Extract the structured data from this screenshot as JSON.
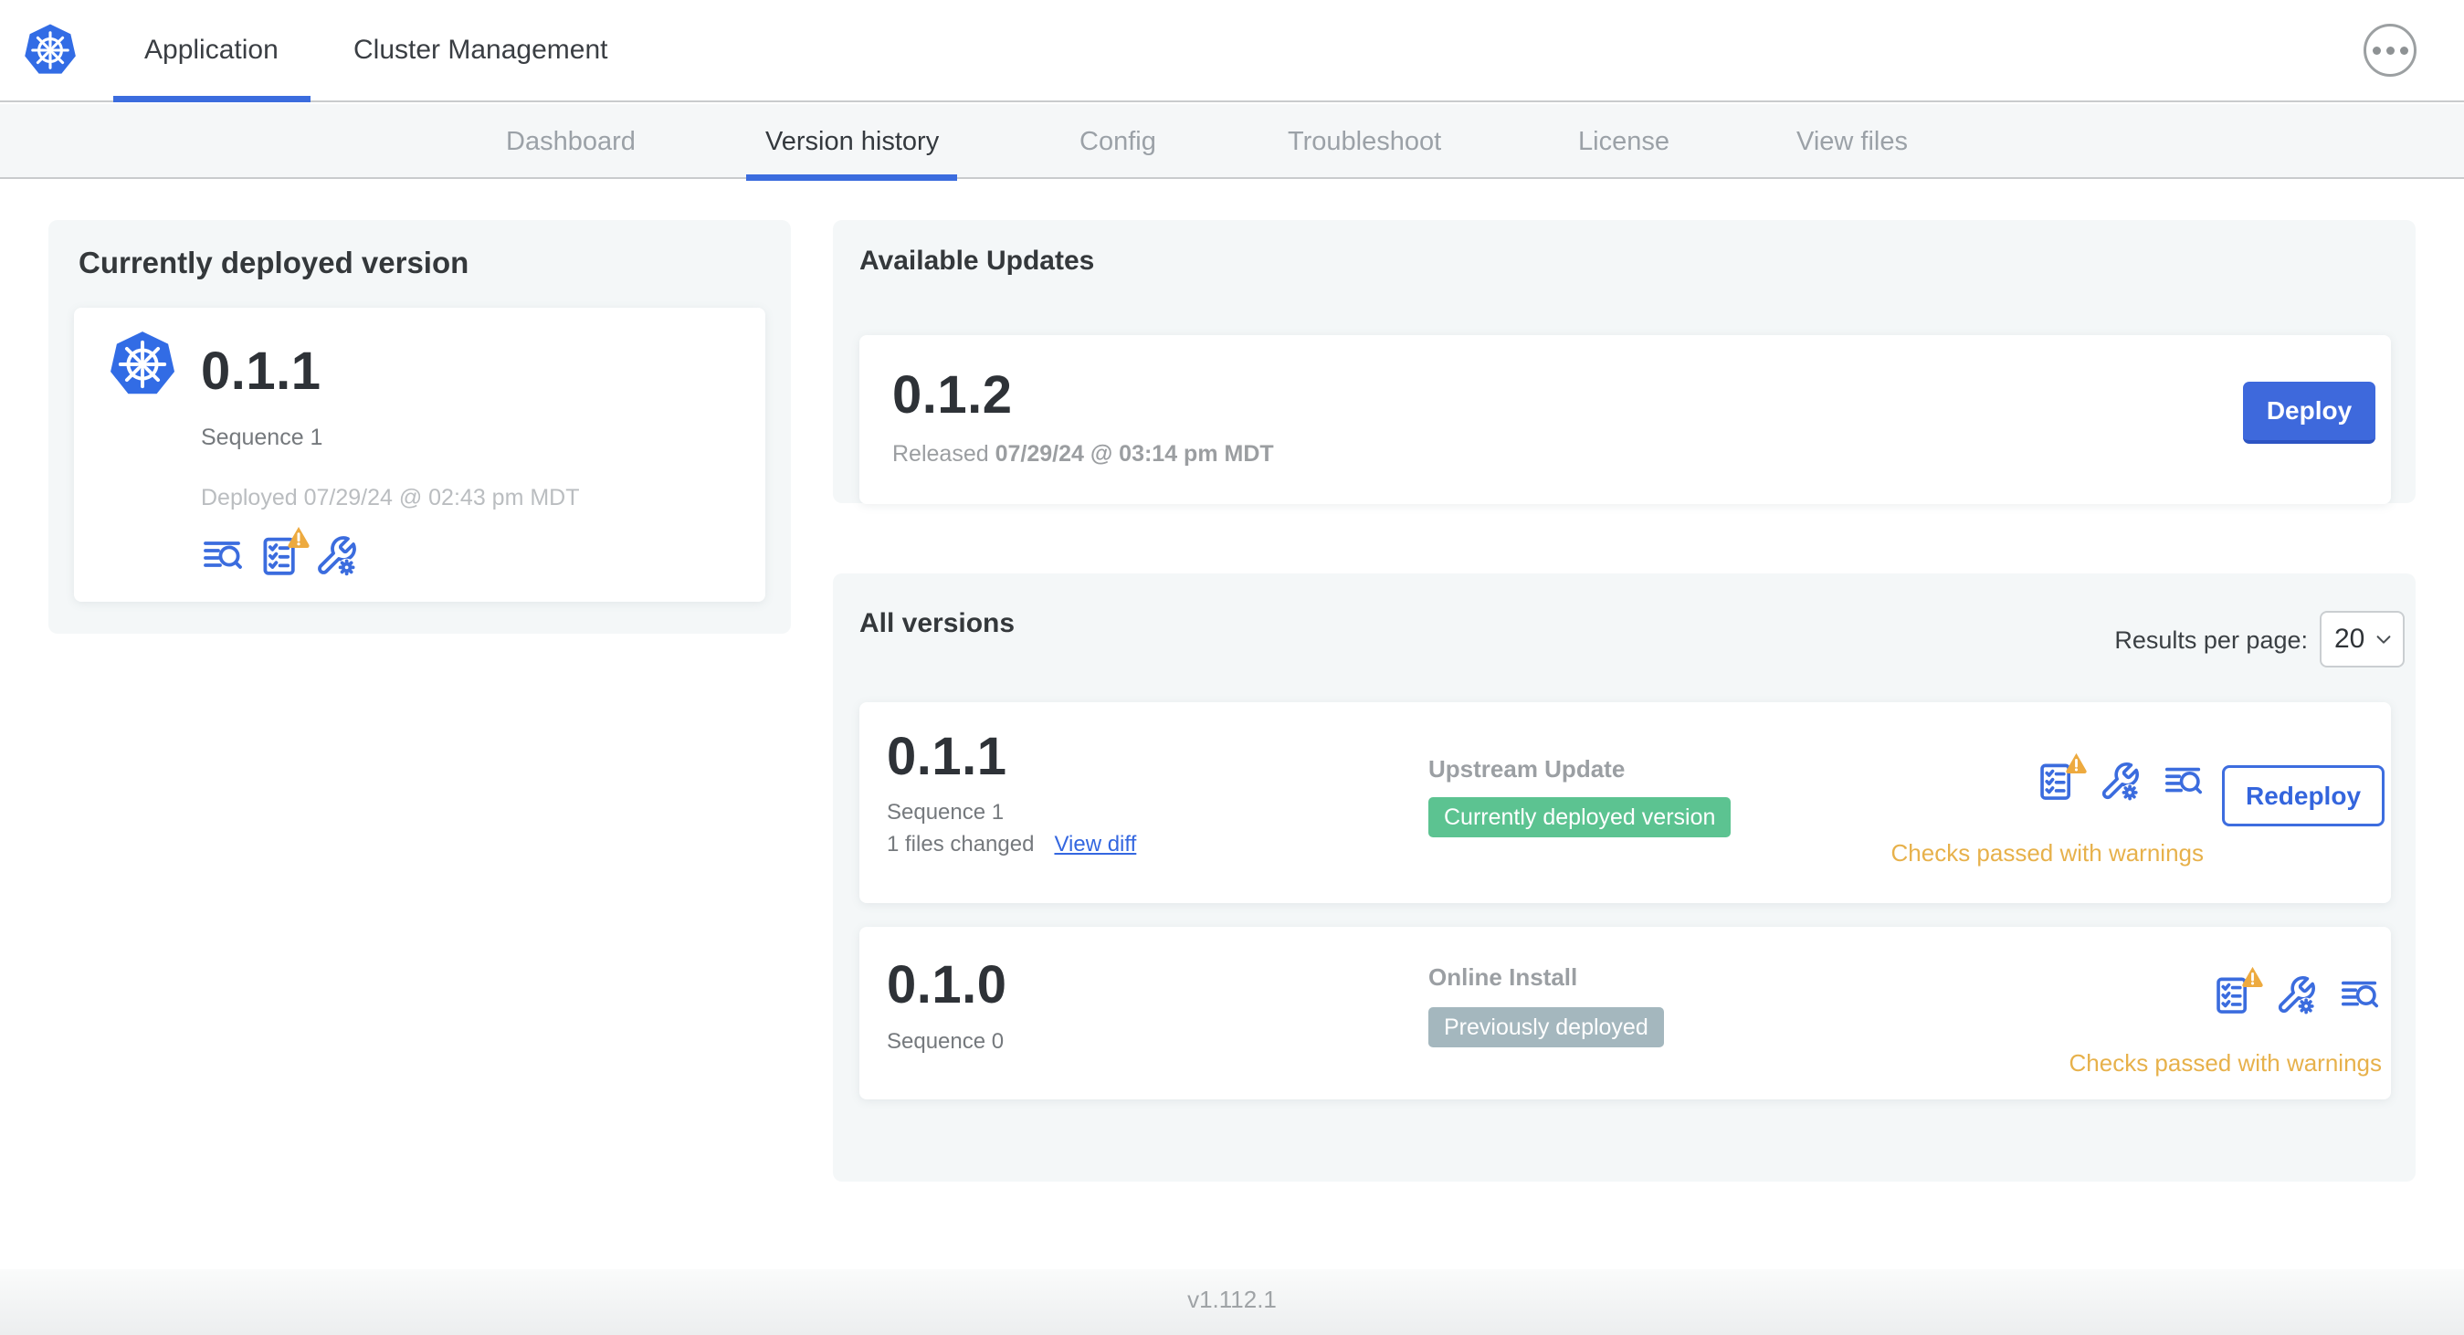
{
  "header": {
    "logo_icon": "kubernetes-logo",
    "tabs": [
      {
        "label": "Application",
        "active": true
      },
      {
        "label": "Cluster Management",
        "active": false
      }
    ],
    "menu_icon": "ellipsis-icon"
  },
  "subnav": {
    "items": [
      {
        "label": "Dashboard",
        "active": false
      },
      {
        "label": "Version history",
        "active": true
      },
      {
        "label": "Config",
        "active": false
      },
      {
        "label": "Troubleshoot",
        "active": false
      },
      {
        "label": "License",
        "active": false
      },
      {
        "label": "View files",
        "active": false
      }
    ]
  },
  "current_version": {
    "title": "Currently deployed version",
    "version": "0.1.1",
    "sequence": "Sequence 1",
    "deployed": "Deployed 07/29/24 @ 02:43 pm MDT",
    "icons": [
      "diff-logs-icon",
      "preflight-checks-warning-icon",
      "config-wrench-icon"
    ]
  },
  "available_updates": {
    "title": "Available Updates",
    "version": "0.1.2",
    "released_prefix": "Released ",
    "released_date": "07/29/24 @ 03:14 pm MDT",
    "deploy_label": "Deploy"
  },
  "all_versions": {
    "title": "All versions",
    "results_per_page_label": "Results per page:",
    "results_per_page_value": "20",
    "rows": [
      {
        "version": "0.1.1",
        "sequence": "Sequence 1",
        "files_changed": "1 files changed",
        "view_diff_label": "View diff",
        "source": "Upstream Update",
        "badge": "Currently deployed version",
        "badge_color": "#5cc391",
        "icons": [
          "preflight-checks-warning-icon",
          "config-wrench-icon",
          "diff-logs-icon"
        ],
        "action_label": "Redeploy",
        "status": "Checks passed with warnings"
      },
      {
        "version": "0.1.0",
        "sequence": "Sequence 0",
        "source": "Online Install",
        "badge": "Previously deployed",
        "badge_color": "#a4b7be",
        "icons": [
          "preflight-checks-warning-icon",
          "config-wrench-icon",
          "diff-logs-icon"
        ],
        "status": "Checks passed with warnings"
      }
    ]
  },
  "footer": {
    "version": "v1.112.1"
  },
  "colors": {
    "accent_blue": "#3b6cde",
    "deploy_button_blue": "#3e69dc",
    "green_badge": "#5cc391",
    "gray_badge": "#a4b7be",
    "warning_text": "#e7b14b",
    "warning_triangle": "#edaa3f",
    "k8s_logo_blue": "#326ce5",
    "section_card_bg": "#f4f7f8"
  }
}
